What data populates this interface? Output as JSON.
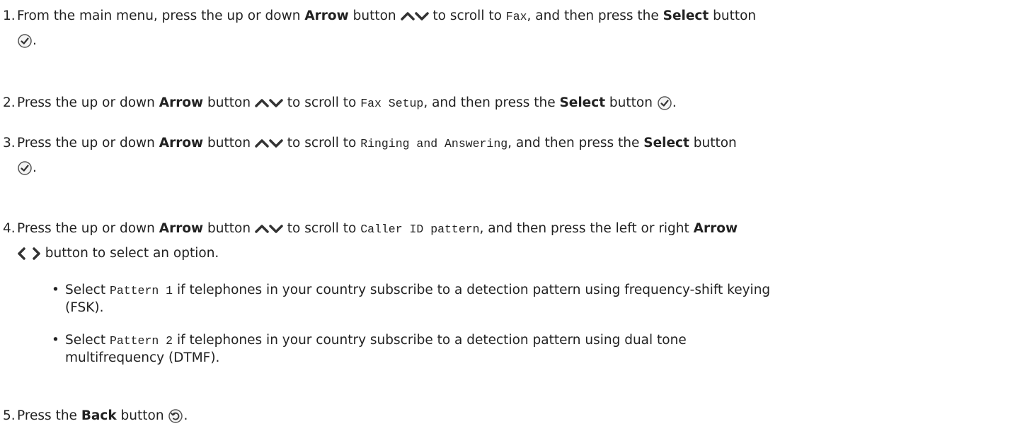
{
  "steps": [
    {
      "num": "1.",
      "t1": "From the main menu, press the up or down ",
      "b1": "Arrow",
      "t2": " button ",
      "t3": " to scroll to ",
      "m1": "Fax",
      "t4": ", and then press the ",
      "b2": "Select",
      "t5": " button",
      "t6": "."
    },
    {
      "num": "2.",
      "t1": "Press the up or down ",
      "b1": "Arrow",
      "t2": " button ",
      "t3": " to scroll to ",
      "m1": "Fax Setup",
      "t4": ", and then press the ",
      "b2": "Select",
      "t5": " button ",
      "t6": "."
    },
    {
      "num": "3.",
      "t1": "Press the up or down ",
      "b1": "Arrow",
      "t2": " button ",
      "t3": " to scroll to ",
      "m1": "Ringing and Answering",
      "t4": ", and then press the ",
      "b2": "Select",
      "t5": " button",
      "t6": "."
    },
    {
      "num": "4.",
      "t1": "Press the up or down ",
      "b1": "Arrow",
      "t2": " button ",
      "t3": " to scroll to ",
      "m1": "Caller ID pattern",
      "t4": ", and then press the left or right ",
      "b2": "Arrow",
      "t5": " button to select an option."
    },
    {
      "num": "5.",
      "t1": "Press the ",
      "b1": "Back",
      "t2": " button ",
      "t3": "."
    }
  ],
  "bullets": [
    {
      "pre": "Select ",
      "code": "Pattern 1",
      "line1": " if telephones in your country subscribe to a detection pattern using frequency-shift keying",
      "line2": "(FSK)."
    },
    {
      "pre": "Select ",
      "code": "Pattern 2",
      "line1": " if telephones in your country subscribe to a detection pattern using dual tone",
      "line2": "multifrequency (DTMF)."
    }
  ],
  "icons": {
    "arrow_up": "chevron-up-icon",
    "arrow_down": "chevron-down-icon",
    "arrow_left": "chevron-left-icon",
    "arrow_right": "chevron-right-icon",
    "select": "select-check-icon",
    "back": "back-arrow-icon"
  },
  "colors": {
    "text": "#222222",
    "icon": "#333333"
  }
}
